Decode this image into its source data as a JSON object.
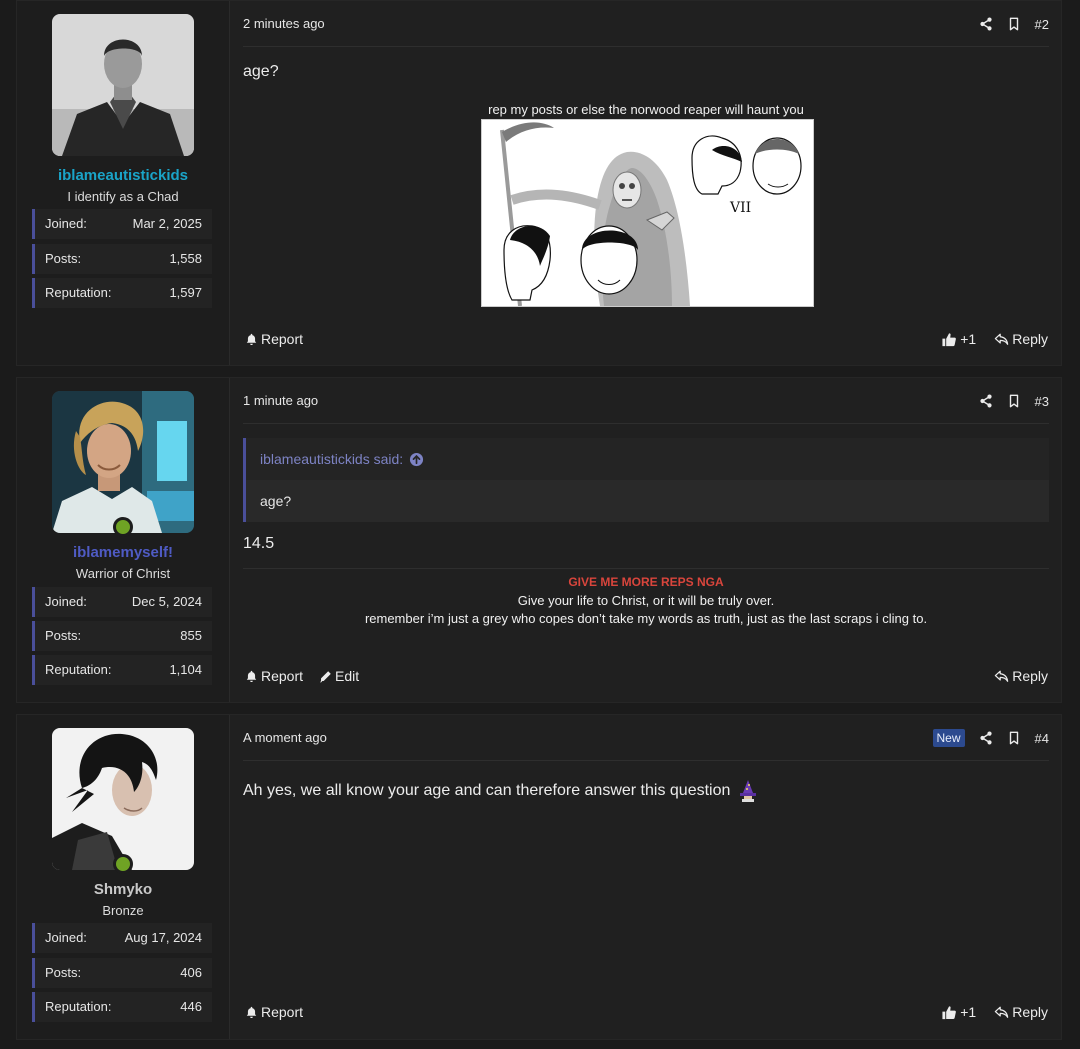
{
  "colors": {
    "username_1": "#1aa4c8",
    "username_2": "#4f5bc4",
    "username_3": "#c9c9c9",
    "sig_red": "#d9453c",
    "online": "#6fa324",
    "stat_border": "#4a4f9a"
  },
  "posts": [
    {
      "username": "iblameautistickids",
      "user_title": "I identify as a Chad",
      "stats": [
        {
          "label": "Joined:",
          "value": "Mar 2, 2025"
        },
        {
          "label": "Posts:",
          "value": "1,558"
        },
        {
          "label": "Reputation:",
          "value": "1,597"
        }
      ],
      "time": "2 minutes ago",
      "number": "#2",
      "body": "age?",
      "signature_caption": "rep my posts or else the norwood reaper will haunt you",
      "signature_image_text": "VII",
      "actions_left": [
        "Report"
      ],
      "like_count": "+1",
      "reply": "Reply"
    },
    {
      "username": "iblamemyself!",
      "user_title": "Warrior of Christ",
      "stats": [
        {
          "label": "Joined:",
          "value": "Dec 5, 2024"
        },
        {
          "label": "Posts:",
          "value": "855"
        },
        {
          "label": "Reputation:",
          "value": "1,104"
        }
      ],
      "time": "1 minute ago",
      "number": "#3",
      "quote_author": "iblameautistickids said:",
      "quote_text": "age?",
      "body": "14.5",
      "signature_line1": "GIVE ME MORE REPS NGA",
      "signature_line2": "Give your life to Christ, or it will be truly over.",
      "signature_line3": "remember i’m just a grey who copes don’t take my words as truth, just as the last scraps i cling to.",
      "actions_left": [
        "Report",
        "Edit"
      ],
      "reply": "Reply"
    },
    {
      "username": "Shmyko",
      "user_title": "Bronze",
      "stats": [
        {
          "label": "Joined:",
          "value": "Aug 17, 2024"
        },
        {
          "label": "Posts:",
          "value": "406"
        },
        {
          "label": "Reputation:",
          "value": "446"
        }
      ],
      "time": "A moment ago",
      "badge": "New",
      "number": "#4",
      "body": "Ah yes, we all know your age and can therefore answer this question",
      "body_emoji": "wizard-emoji",
      "actions_left": [
        "Report"
      ],
      "like_count": "+1",
      "reply": "Reply"
    }
  ]
}
